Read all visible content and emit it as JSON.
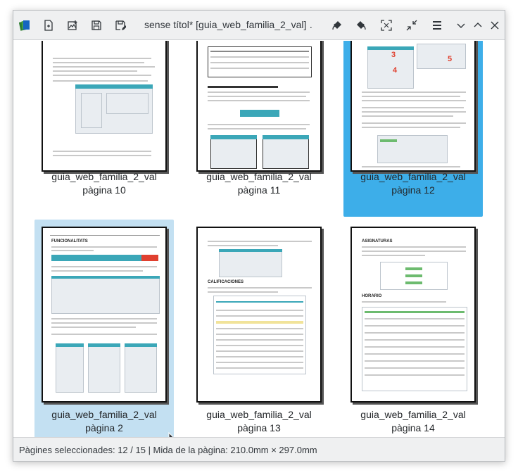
{
  "window": {
    "title": "sense títol* [guia_web_familia_2_val] …"
  },
  "toolbar": {
    "icons": [
      "app-icon",
      "new-page-icon",
      "insert-image-icon",
      "save-icon",
      "save-as-icon",
      "rotate-left-icon",
      "rotate-right-icon",
      "zoom-fit-icon",
      "zoom-out-icon",
      "menu-icon",
      "minimize-icon",
      "maximize-icon",
      "close-icon"
    ]
  },
  "pages": [
    {
      "doc": "guia_web_familia_2_val",
      "page": "pàgina 10",
      "selected": "none"
    },
    {
      "doc": "guia_web_familia_2_val",
      "page": "pàgina 11",
      "selected": "none"
    },
    {
      "doc": "guia_web_familia_2_val",
      "page": "pàgina 12",
      "selected": "strong"
    },
    {
      "doc": "guia_web_familia_2_val",
      "page": "pàgina 2",
      "selected": "light"
    },
    {
      "doc": "guia_web_familia_2_val",
      "page": "pàgina 13",
      "selected": "none"
    },
    {
      "doc": "guia_web_familia_2_val",
      "page": "pàgina 14",
      "selected": "none"
    }
  ],
  "thumb_text": {
    "p12_n3": "3",
    "p12_n4": "4",
    "p12_n5": "5",
    "p2_heading": "FUNCIONALITATS",
    "p13_heading": "CALIFICACIONES",
    "p14_heading": "ASIGNATURAS",
    "p14_heading2": "HORARIO"
  },
  "status": {
    "text": "Pàgines seleccionades: 12 / 15 | Mida de la pàgina: 210.0mm × 297.0mm"
  },
  "colors": {
    "selection_strong": "#3daee9",
    "selection_light": "#c3e0f2",
    "chrome": "#eff0f1"
  }
}
